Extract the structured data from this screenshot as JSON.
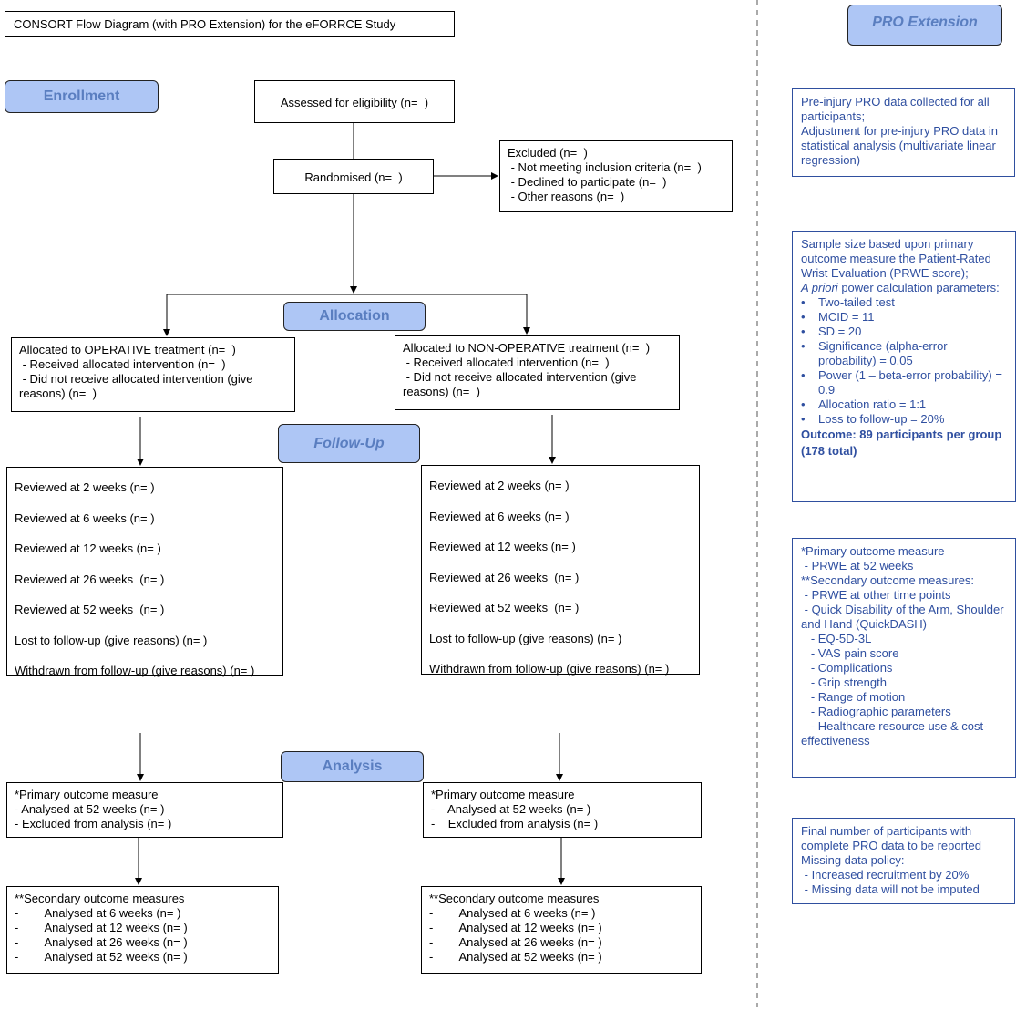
{
  "title": "CONSORT Flow Diagram (with PRO Extension) for the eFORRCE Study",
  "stages": {
    "enrollment": "Enrollment",
    "allocation": "Allocation",
    "follow_up": "Follow-Up",
    "analysis": "Analysis",
    "pro_extension": "PRO Extension"
  },
  "colors": {
    "stage_fill": "#aec6f5",
    "stage_text": "#5a7ec0",
    "pro_text": "#2f4fa0"
  },
  "boxes": {
    "assessed": [
      "Assessed for eligibility (n=  )"
    ],
    "randomised": [
      "Randomised (n=  )"
    ],
    "excluded": [
      "Excluded (n=  )",
      " - Not meeting inclusion criteria (n=  )",
      " - Declined to participate (n=  )",
      " - Other reasons (n=  )"
    ],
    "alloc_operative": [
      "Allocated to OPERATIVE treatment (n=  )",
      " - Received allocated intervention (n=  )",
      " - Did not receive allocated intervention (give",
      "reasons) (n=  )"
    ],
    "alloc_nonoperative": [
      "Allocated to NON-OPERATIVE treatment (n=  )",
      " - Received allocated intervention (n=  )",
      " - Did not receive allocated intervention (give",
      "reasons) (n=  )"
    ],
    "follow_left": [
      "Reviewed at 2 weeks (n= )",
      "Reviewed at 6 weeks (n= )",
      "Reviewed at 12 weeks (n= )",
      "Reviewed at 26 weeks  (n= )",
      "Reviewed at 52 weeks  (n= )",
      "Lost to follow-up (give reasons) (n= )",
      "Withdrawn from follow-up (give reasons) (n= )"
    ],
    "follow_right": [
      "Reviewed at 2 weeks (n= )",
      "Reviewed at 6 weeks (n= )",
      "Reviewed at 12 weeks (n= )",
      "Reviewed at 26 weeks  (n= )",
      "Reviewed at 52 weeks  (n= )",
      "Lost to follow-up (give reasons) (n= )",
      "Withdrawn from follow-up (give reasons) (n= )"
    ],
    "primary_left": [
      "*Primary outcome measure",
      "- Analysed at 52 weeks (n= )",
      "- Excluded from analysis (n= )"
    ],
    "primary_right": [
      "*Primary outcome measure",
      "-    Analysed at 52 weeks (n= )",
      "-    Excluded from analysis (n= )"
    ],
    "secondary_left": [
      "**Secondary outcome measures",
      "-        Analysed at 6 weeks (n= )",
      "-        Analysed at 12 weeks (n= )",
      "-        Analysed at 26 weeks (n= )",
      "-        Analysed at 52 weeks (n= )"
    ],
    "secondary_right": [
      "**Secondary outcome measures",
      "-        Analysed at 6 weeks (n= )",
      "-        Analysed at 12 weeks (n= )",
      "-        Analysed at 26 weeks (n= )",
      "-        Analysed at 52 weeks (n= )"
    ]
  },
  "pro": {
    "box1": [
      "Pre-injury PRO data collected for all participants;",
      "Adjustment for pre-injury PRO data in statistical analysis (multivariate linear regression)"
    ],
    "box2": {
      "intro": "Sample size based upon primary outcome measure the Patient-Rated Wrist Evaluation (PRWE score);",
      "apriori_italic": "A priori",
      "apriori_rest": " power calculation parameters:",
      "bullet": "•",
      "bullets": [
        "Two-tailed test",
        "MCID = 11",
        "SD = 20",
        "Significance (alpha-error probability) = 0.05",
        "Power (1 – beta-error probability) = 0.9",
        "Allocation ratio = 1:1",
        "Loss to follow-up = 20%"
      ],
      "outcome": "Outcome: 89 participants per group (178 total)"
    },
    "box3": [
      "*Primary outcome measure",
      " - PRWE at 52 weeks",
      "**Secondary outcome measures:",
      " - PRWE at other time points",
      " - Quick Disability of the Arm, Shoulder and Hand (QuickDASH)",
      "   - EQ-5D-3L",
      "   - VAS pain score",
      "   - Complications",
      "   - Grip strength",
      "   - Range of motion",
      "   - Radiographic parameters",
      "   - Healthcare resource use & cost-effectiveness"
    ],
    "box4": [
      "Final number of participants with complete PRO data to be reported",
      "Missing data policy:",
      " - Increased recruitment by 20%",
      " - Missing data will not be imputed"
    ]
  }
}
